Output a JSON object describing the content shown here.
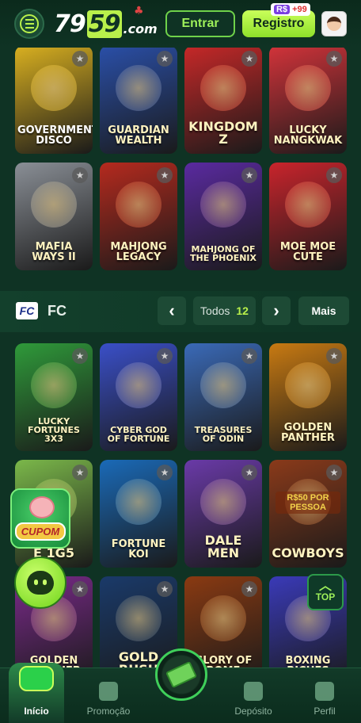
{
  "header": {
    "logo_number_a": "79",
    "logo_number_b": "59",
    "logo_domain": ".com",
    "login_label": "Entrar",
    "register_label": "Registro",
    "register_badge_currency": "R$",
    "register_badge_amount": "+99"
  },
  "games_top": [
    {
      "title": "GOVERNMENT DISCO",
      "color": "#d9b020"
    },
    {
      "title": "GUARDIAN WEALTH",
      "color": "#2a4fa8"
    },
    {
      "title": "KINGDOM Z",
      "color": "#c62828"
    },
    {
      "title": "LUCKY NANGKWAK",
      "color": "#d2333a"
    },
    {
      "title": "MAFIA WAYS II",
      "color": "#8a8f96"
    },
    {
      "title": "MAHJONG LEGACY",
      "color": "#b52a1e"
    },
    {
      "title": "MAHJONG OF THE PHOENIX",
      "color": "#5a2aa0"
    },
    {
      "title": "MOE MOE CUTE",
      "color": "#c9242c"
    }
  ],
  "section": {
    "provider_logo": "FC",
    "title": "FC",
    "prev_label": "‹",
    "next_label": "›",
    "todos_label": "Todos",
    "todos_count": "12",
    "more_label": "Mais"
  },
  "games_fc": [
    {
      "title": "LUCKY FORTUNES 3X3",
      "color": "#2f9a3a"
    },
    {
      "title": "CYBER GOD OF FORTUNE",
      "color": "#3a4fc8"
    },
    {
      "title": "TREASURES OF ODIN",
      "color": "#3a6ab8"
    },
    {
      "title": "GOLDEN PANTHER",
      "color": "#c87a12"
    },
    {
      "title": "E 1G5",
      "color": "#7bb84a"
    },
    {
      "title": "FORTUNE KOI",
      "color": "#1a6ab8"
    },
    {
      "title": "DALE MEN",
      "color": "#6a3aa8"
    },
    {
      "title": "COWBOYS",
      "color": "#8a3a1a"
    },
    {
      "title": "GOLDEN PANTHER",
      "color": "#7a2a8a"
    },
    {
      "title": "GOLD RUSH",
      "color": "#1a3a6a"
    },
    {
      "title": "GLORY OF ROME",
      "color": "#8a3a12"
    },
    {
      "title": "BOXING RICHES",
      "color": "#3a3ab8"
    }
  ],
  "promo": {
    "cupom_label": "CUPOM",
    "cowboys_banner": "R$50 POR PESSOA"
  },
  "top_button_label": "TOP",
  "bottom_nav": [
    {
      "label": "Início",
      "icon": "gamepad-icon"
    },
    {
      "label": "Promoção",
      "icon": "gift-icon"
    },
    {
      "label": "Depósito",
      "icon": "money-bag-icon"
    },
    {
      "label": "Perfil",
      "icon": "user-icon"
    }
  ]
}
